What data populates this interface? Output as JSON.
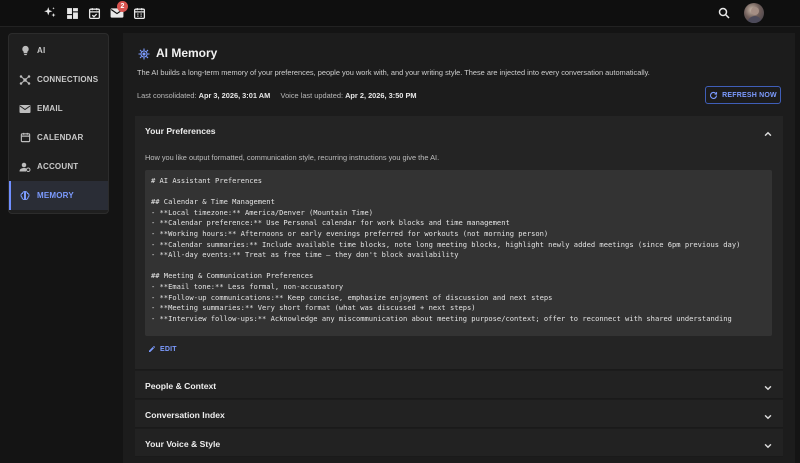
{
  "topbar": {
    "icons": [
      "sparkle-icon",
      "dashboard-icon",
      "calendar-check-icon",
      "mail-icon",
      "calendar-grid-icon"
    ],
    "mail_badge": "2",
    "right_icons": [
      "search-icon",
      "avatar"
    ]
  },
  "sidebar": {
    "items": [
      {
        "label": "AI",
        "icon": "lightbulb-icon",
        "active": false
      },
      {
        "label": "CONNECTIONS",
        "icon": "hub-icon",
        "active": false
      },
      {
        "label": "EMAIL",
        "icon": "mail-icon",
        "active": false
      },
      {
        "label": "CALENDAR",
        "icon": "calendar-icon",
        "active": false
      },
      {
        "label": "ACCOUNT",
        "icon": "account-icon",
        "active": false
      },
      {
        "label": "MEMORY",
        "icon": "memory-icon",
        "active": true
      }
    ]
  },
  "main": {
    "title": "AI Memory",
    "description": "The AI builds a long-term memory of your preferences, people you work with, and your writing style. These are injected into every conversation automatically.",
    "consolidated_label": "Last consolidated:",
    "consolidated_value": "Apr 3, 2026, 3:01 AM",
    "voice_label": "Voice last updated:",
    "voice_value": "Apr 2, 2026, 3:50 PM",
    "refresh_label": "REFRESH NOW",
    "preferences": {
      "title": "Your Preferences",
      "subtitle": "How you like output formatted, communication style, recurring instructions you give the AI.",
      "content": "# AI Assistant Preferences\n\n## Calendar & Time Management\n- **Local timezone:** America/Denver (Mountain Time)\n- **Calendar preference:** Use Personal calendar for work blocks and time management\n- **Working hours:** Afternoons or early evenings preferred for workouts (not morning person)\n- **Calendar summaries:** Include available time blocks, note long meeting blocks, highlight newly added meetings (since 6pm previous day)\n- **All-day events:** Treat as free time — they don't block availability\n\n## Meeting & Communication Preferences\n- **Email tone:** Less formal, non-accusatory\n- **Follow-up communications:** Keep concise, emphasize enjoyment of discussion and next steps\n- **Meeting summaries:** Very short format (what was discussed + next steps)\n- **Interview follow-ups:** Acknowledge any miscommunication about meeting purpose/context; offer to reconnect with shared understanding",
      "edit_label": "EDIT"
    },
    "sections": [
      {
        "title": "People & Context"
      },
      {
        "title": "Conversation Index"
      },
      {
        "title": "Your Voice & Style"
      }
    ]
  },
  "colors": {
    "accent": "#7c9bff",
    "background": "#141414",
    "panel": "#1c1c1c",
    "badge": "#d9534f"
  }
}
